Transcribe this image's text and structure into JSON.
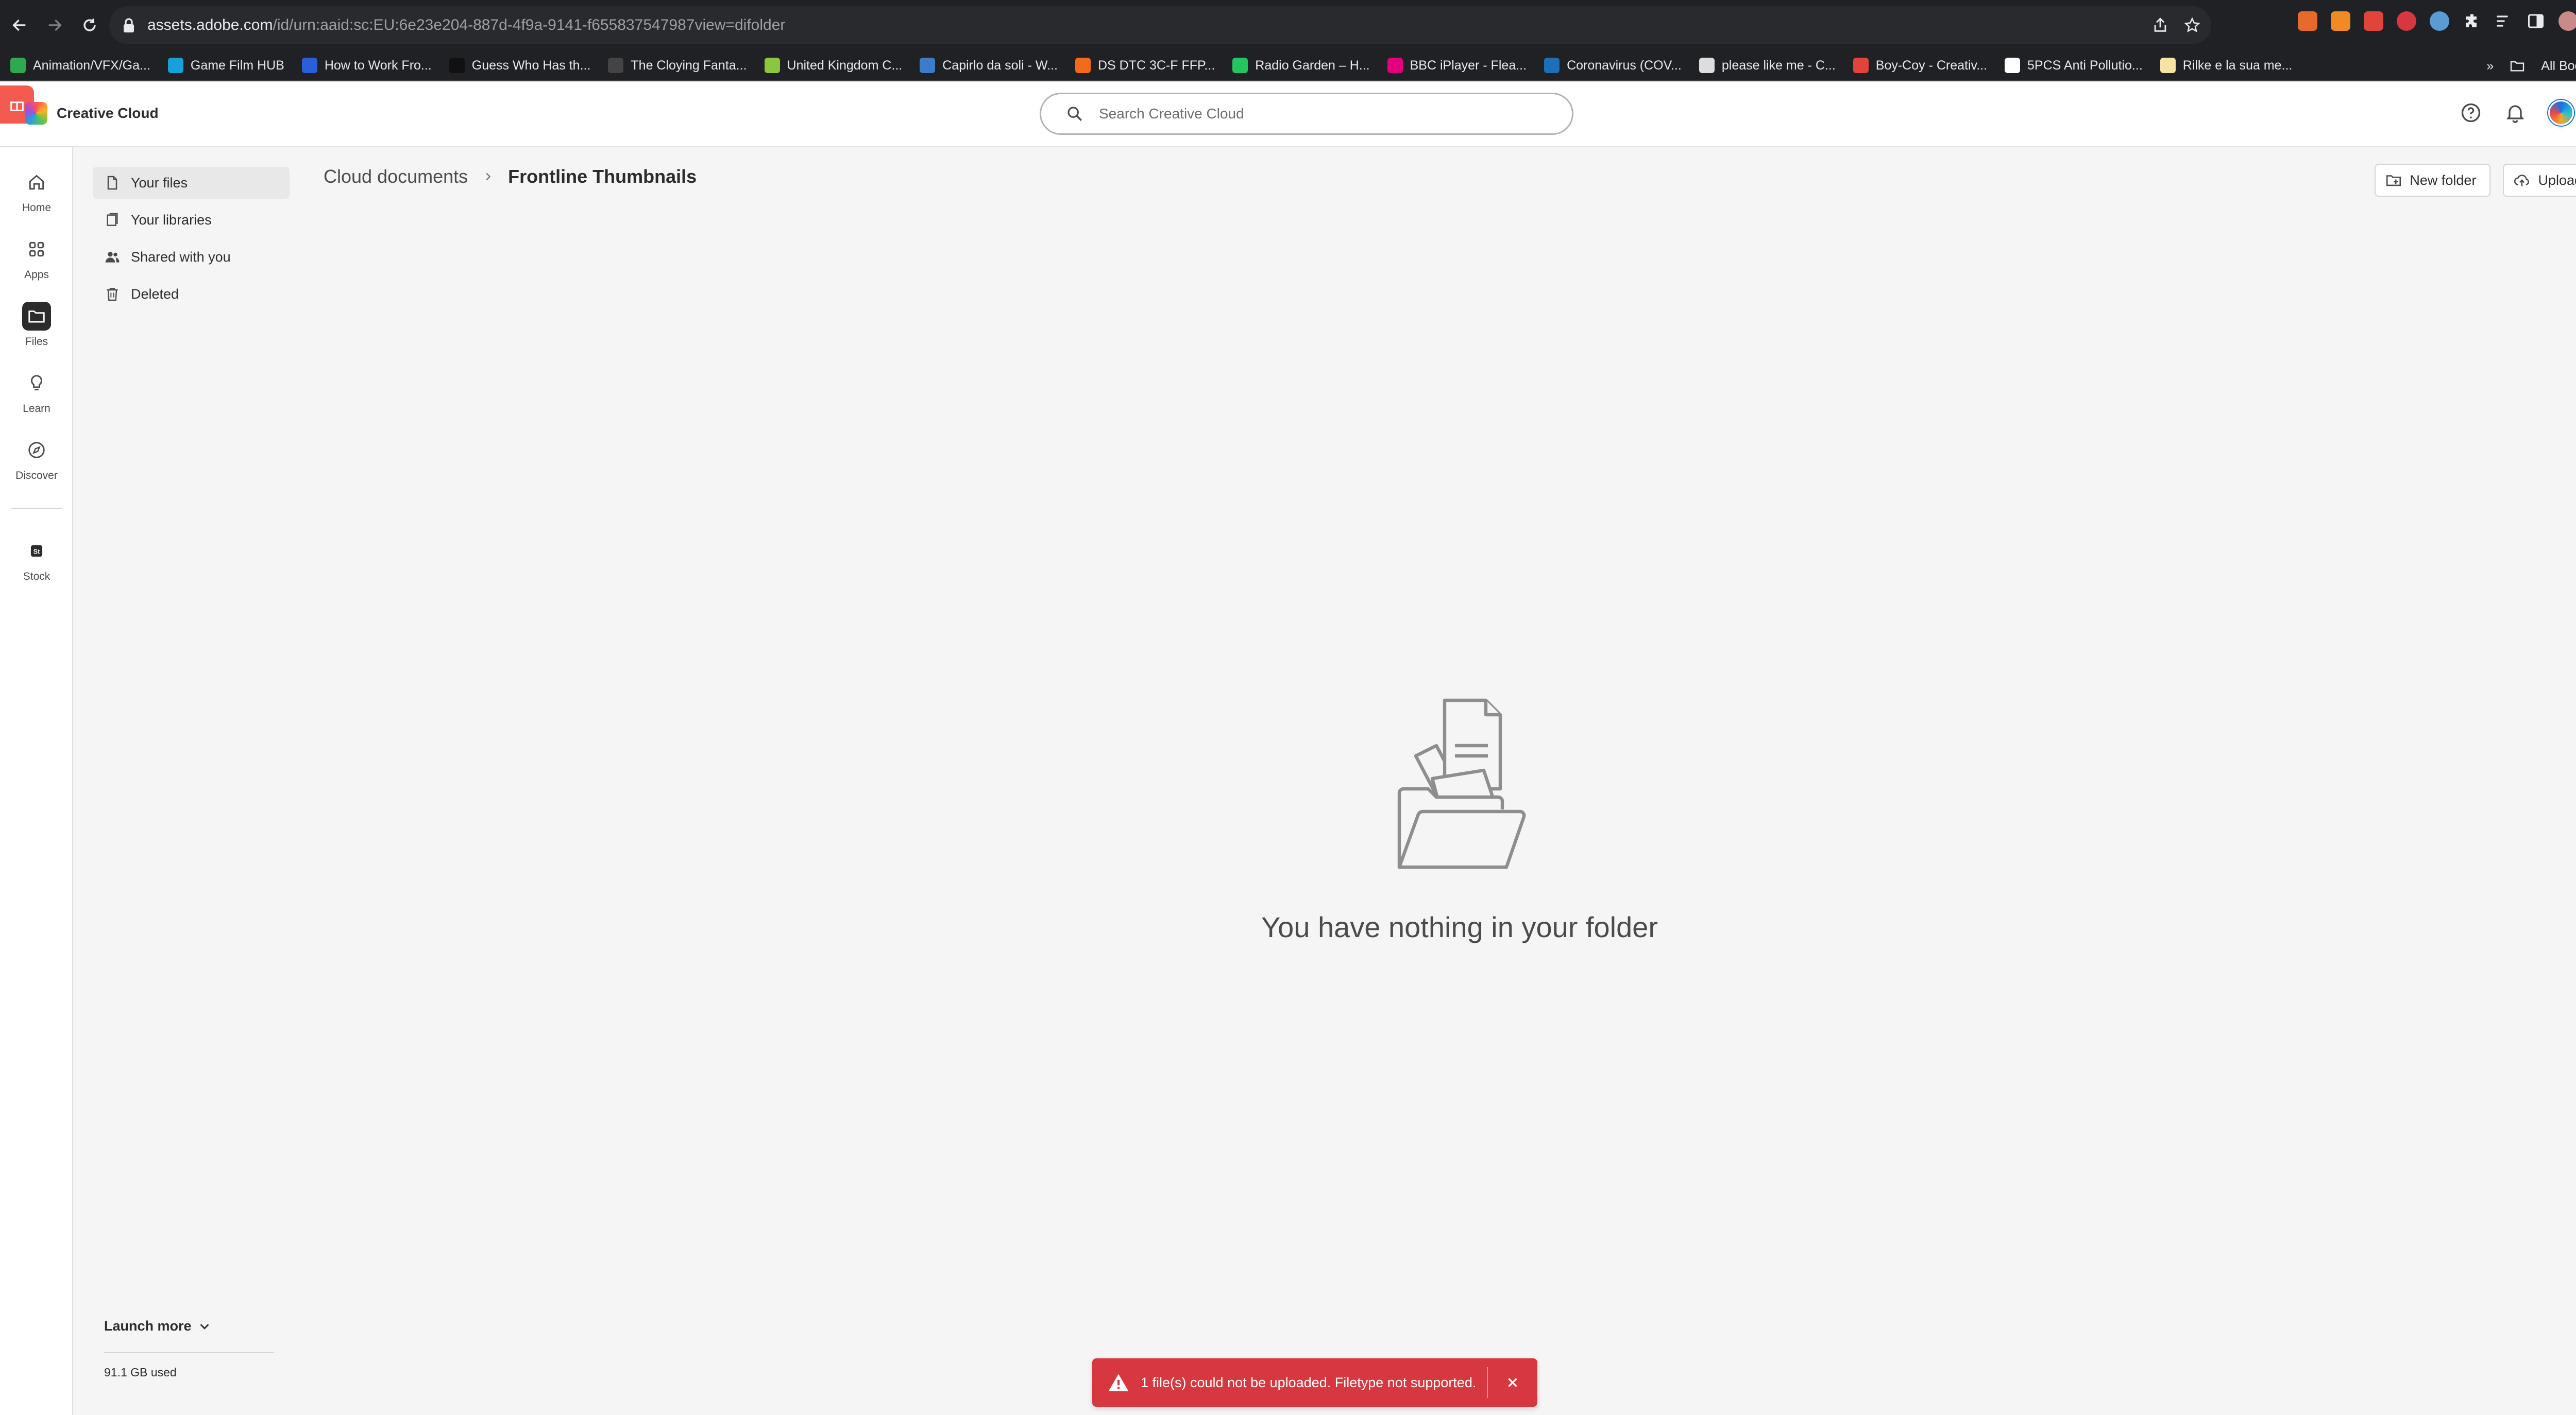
{
  "browser": {
    "url_host": "assets.adobe.com",
    "url_path": "/id/urn:aaid:sc:EU:6e23e204-887d-4f9a-9141-f655837547987view=difolder",
    "bookmarks": [
      {
        "label": "Animation/VFX/Ga...",
        "color": "#2fa84f"
      },
      {
        "label": "Game Film HUB",
        "color": "#1aa0d8"
      },
      {
        "label": "How to Work Fro...",
        "color": "#2b5fd9"
      },
      {
        "label": "Guess Who Has th...",
        "color": "#111111"
      },
      {
        "label": "The Cloying Fanta...",
        "color": "#444444"
      },
      {
        "label": "United Kingdom C...",
        "color": "#8cc63f"
      },
      {
        "label": "Capirlo da soli - W...",
        "color": "#3d7cc9"
      },
      {
        "label": "DS DTC 3C-F FFP...",
        "color": "#f26b1d"
      },
      {
        "label": "Radio Garden – H...",
        "color": "#22c55e"
      },
      {
        "label": "BBC iPlayer - Flea...",
        "color": "#e4007c"
      },
      {
        "label": "Coronavirus (COV...",
        "color": "#1d70b8"
      },
      {
        "label": "please like me - C...",
        "color": "#dddddd"
      },
      {
        "label": "Boy-Coy - Creativ...",
        "color": "#e0443a"
      },
      {
        "label": "5PCS Anti Pollutio...",
        "color": "#ffffff"
      },
      {
        "label": "Rilke e la sua me...",
        "color": "#f4e3a1"
      }
    ],
    "all_bookmarks": "All Bookmarks"
  },
  "header": {
    "brand": "Creative Cloud",
    "search_placeholder": "Search Creative Cloud"
  },
  "rail": {
    "items": [
      {
        "label": "Home",
        "icon": "home-icon"
      },
      {
        "label": "Apps",
        "icon": "apps-icon"
      },
      {
        "label": "Files",
        "icon": "folder-icon"
      },
      {
        "label": "Learn",
        "icon": "lightbulb-icon"
      },
      {
        "label": "Discover",
        "icon": "compass-icon"
      },
      {
        "label": "Stock",
        "icon": "stock-icon"
      }
    ]
  },
  "subnav": {
    "items": [
      {
        "label": "Your files",
        "icon": "file-icon"
      },
      {
        "label": "Your libraries",
        "icon": "libraries-icon"
      },
      {
        "label": "Shared with you",
        "icon": "people-icon"
      },
      {
        "label": "Deleted",
        "icon": "trash-icon"
      }
    ],
    "launch_more": "Launch more",
    "storage": "91.1 GB used"
  },
  "main": {
    "breadcrumb_parent": "Cloud documents",
    "breadcrumb_current": "Frontline Thumbnails",
    "new_folder": "New folder",
    "upload": "Upload",
    "empty_message": "You have nothing in your folder"
  },
  "toast": {
    "message": "1 file(s) could not be uploaded. Filetype not supported.",
    "color": "#d7373f"
  }
}
